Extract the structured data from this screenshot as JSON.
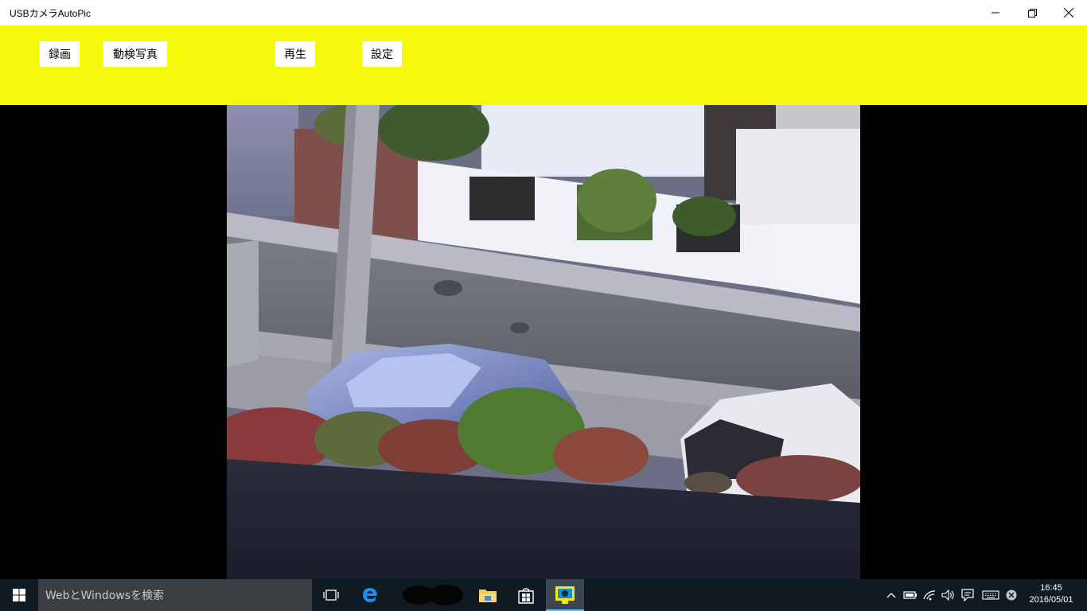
{
  "window": {
    "title": "USBカメラAutoPic",
    "controls": [
      "minimize-icon",
      "restore-icon",
      "close-icon"
    ]
  },
  "toolbar": {
    "background": "#f5f90c",
    "buttons": [
      {
        "label": "録画"
      },
      {
        "label": "動検写真"
      },
      {
        "label": "再生"
      },
      {
        "label": "設定"
      }
    ]
  },
  "camera_view": {
    "scene": "street view from above: road, utility pole, white wall, parked blue car, white car, shrubs"
  },
  "taskbar": {
    "search_placeholder": "WebとWindowsを検索",
    "pinned": [
      "windows-start-icon",
      "task-view-icon",
      "edge-icon",
      "blurred-app-icon",
      "file-explorer-icon",
      "store-icon",
      "usb-camera-app-icon"
    ],
    "tray": [
      "chevron-up-icon",
      "battery-icon",
      "wifi-icon",
      "volume-icon",
      "notification-icon",
      "keyboard-icon",
      "close-circle-icon"
    ],
    "clock": {
      "time": "16:45",
      "date": "2016/05/01"
    }
  }
}
